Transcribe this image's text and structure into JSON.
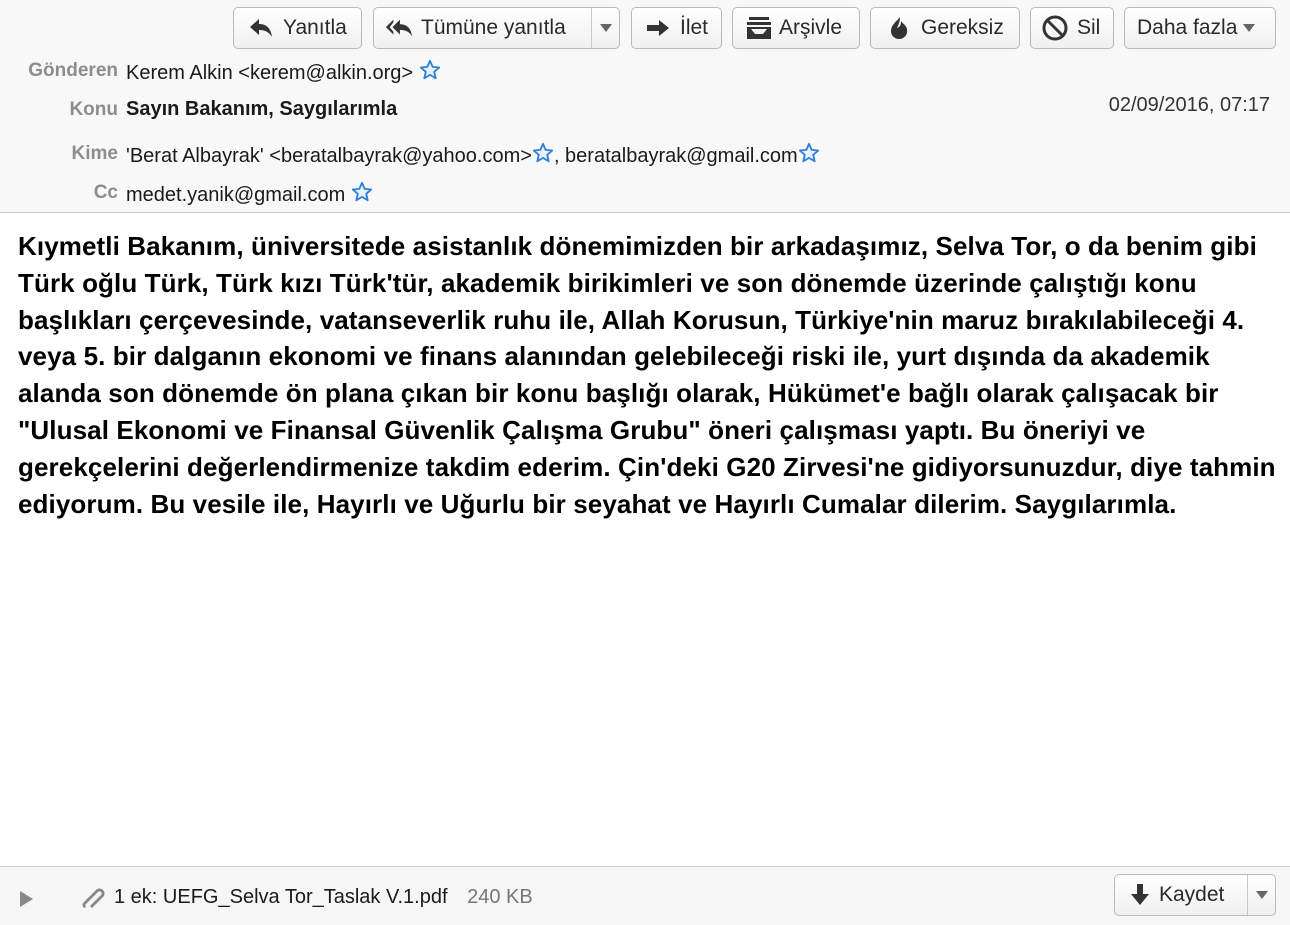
{
  "toolbar": {
    "reply": "Yanıtla",
    "reply_all": "Tümüne yanıtla",
    "forward": "İlet",
    "archive": "Arşivle",
    "junk": "Gereksiz",
    "delete": "Sil",
    "more": "Daha fazla"
  },
  "header": {
    "from_label": "Gönderen",
    "from_value": "Kerem Alkin <kerem@alkin.org>",
    "subject_label": "Konu",
    "subject_value": "Sayın Bakanım, Saygılarımla",
    "date": "02/09/2016, 07:17",
    "to_label": "Kime",
    "to_recipients": [
      "'Berat Albayrak' <beratalbayrak@yahoo.com>",
      ", beratalbayrak@gmail.com"
    ],
    "cc_label": "Cc",
    "cc_value": "medet.yanik@gmail.com"
  },
  "message": {
    "body": "Kıymetli Bakanım, üniversitede asistanlık dönemimizden bir arkadaşımız, Selva Tor, o da benim gibi Türk oğlu Türk, Türk kızı Türk'tür, akademik birikimleri ve son dönemde üzerinde çalıştığı konu başlıkları çerçevesinde, vatanseverlik ruhu ile, Allah Korusun, Türkiye'nin maruz bırakılabileceği 4. veya 5. bir dalganın ekonomi ve finans alanından gelebileceği riski ile, yurt dışında da akademik alanda son dönemde ön plana çıkan bir konu başlığı olarak, Hükümet'e bağlı olarak çalışacak bir \"Ulusal Ekonomi ve Finansal Güvenlik Çalışma Grubu\" öneri çalışması yaptı. Bu öneriyi ve gerekçelerini değerlendirmenize takdim ederim. Çin'deki G20 Zirvesi'ne gidiyorsunuzdur, diye tahmin ediyorum. Bu vesile ile, Hayırlı ve Uğurlu bir seyahat ve Hayırlı Cumalar dilerim. Saygılarımla."
  },
  "attachment": {
    "count_label": "1 ek:",
    "filename": "UEFG_Selva Tor_Taslak V.1.pdf",
    "size": "240 KB",
    "save_label": "Kaydet"
  },
  "colors": {
    "star": "#2f7fd6",
    "label_gray": "#8d8d8d"
  },
  "icons": [
    "reply-icon",
    "reply-all-icon",
    "forward-icon",
    "archive-icon",
    "junk-icon",
    "delete-icon",
    "star-icon",
    "paperclip-icon",
    "download-icon"
  ]
}
